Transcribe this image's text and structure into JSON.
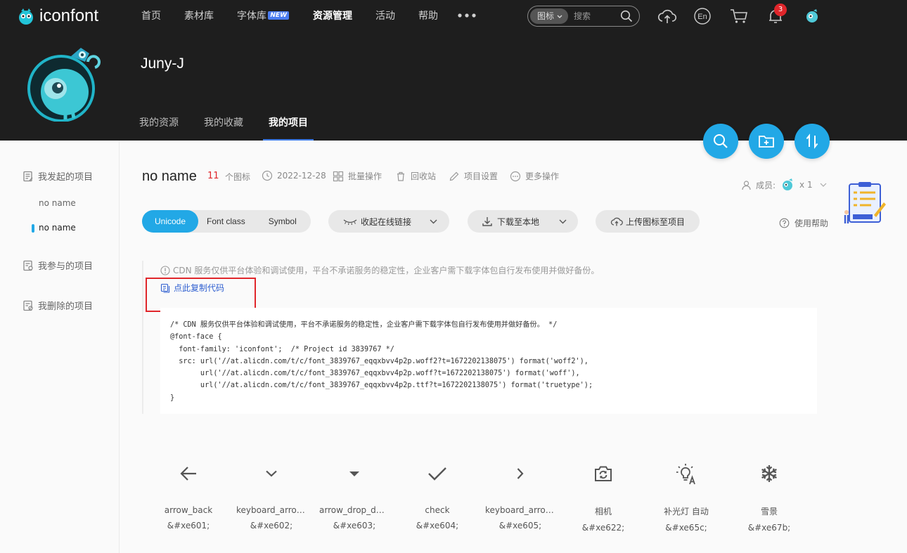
{
  "header": {
    "logo_text": "iconfont",
    "menu": [
      {
        "label": "首页"
      },
      {
        "label": "素材库"
      },
      {
        "label": "字体库",
        "badge": "NEW"
      },
      {
        "label": "资源管理",
        "active": true
      },
      {
        "label": "活动"
      },
      {
        "label": "帮助"
      }
    ],
    "more_dots": "●●●",
    "search": {
      "type_label": "图标",
      "placeholder": "搜索"
    },
    "lang_label": "En",
    "notification_count": "3"
  },
  "profile": {
    "username": "Juny-J",
    "tabs": [
      {
        "label": "我的资源"
      },
      {
        "label": "我的收藏"
      },
      {
        "label": "我的项目",
        "active": true
      }
    ]
  },
  "sidebar": {
    "group_initiated": "我发起的项目",
    "projects": [
      {
        "label": "no name"
      },
      {
        "label": "no name",
        "active": true
      }
    ],
    "group_joined": "我参与的项目",
    "group_deleted": "我删除的项目"
  },
  "project": {
    "name": "no name",
    "icon_count": "11",
    "icon_count_label": "个图标",
    "date": "2022-12-28",
    "actions": {
      "batch": "批量操作",
      "recycle": "回收站",
      "settings": "项目设置",
      "more": "更多操作"
    },
    "members_label": "成员:",
    "members_count": "x 1"
  },
  "toolbar": {
    "formats": [
      {
        "label": "Unicode",
        "active": true
      },
      {
        "label": "Font class"
      },
      {
        "label": "Symbol"
      }
    ],
    "collapse_link": "收起在线链接",
    "download": "下载至本地",
    "upload": "上传图标至项目",
    "help": "使用帮助"
  },
  "code_panel": {
    "notice": "CDN 服务仅供平台体验和调试使用，平台不承诺服务的稳定性，企业客户需下载字体包自行发布使用并做好备份。",
    "copy_label": "点此复制代码",
    "code_lines": [
      "/* CDN 服务仅供平台体验和调试使用，平台不承诺服务的稳定性，企业客户需下载字体包自行发布使用并做好备份。 */",
      "@font-face {",
      "  font-family: 'iconfont';  /* Project id 3839767 */",
      "  src: url('//at.alicdn.com/t/c/font_3839767_eqqxbvv4p2p.woff2?t=1672202138075') format('woff2'),",
      "       url('//at.alicdn.com/t/c/font_3839767_eqqxbvv4p2p.woff?t=1672202138075') format('woff'),",
      "       url('//at.alicdn.com/t/c/font_3839767_eqqxbvv4p2p.ttf?t=1672202138075') format('truetype');",
      "}"
    ]
  },
  "icons": [
    {
      "name": "arrow_back",
      "code": "&#xe601;",
      "icon": "arrow-back-icon"
    },
    {
      "name": "keyboard_arrow...",
      "code": "&#xe602;",
      "icon": "chevron-down-icon"
    },
    {
      "name": "arrow_drop_down",
      "code": "&#xe603;",
      "icon": "caret-down-icon"
    },
    {
      "name": "check",
      "code": "&#xe604;",
      "icon": "check-icon"
    },
    {
      "name": "keyboard_arrow...",
      "code": "&#xe605;",
      "icon": "chevron-right-icon"
    },
    {
      "name": "相机",
      "code": "&#xe622;",
      "icon": "camera-switch-icon"
    },
    {
      "name": "补光灯 自动",
      "code": "&#xe65c;",
      "icon": "auto-fill-light-icon"
    },
    {
      "name": "雪景",
      "code": "&#xe67b;",
      "icon": "snowflake-icon"
    }
  ],
  "colors": {
    "header_bg": "#1e1e1e",
    "accent": "#22a8e6",
    "badge_red": "#e0262b",
    "link_blue": "#2f5fd0"
  }
}
